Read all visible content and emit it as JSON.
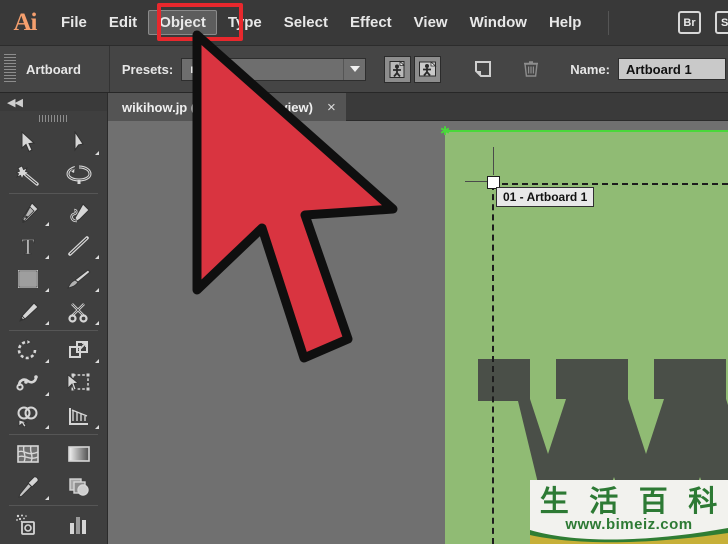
{
  "app": {
    "name": "Adobe Illustrator",
    "logo_text": "Ai"
  },
  "menubar": {
    "items": [
      {
        "label": "File",
        "active": false
      },
      {
        "label": "Edit",
        "active": false
      },
      {
        "label": "Object",
        "active": true
      },
      {
        "label": "Type",
        "active": false
      },
      {
        "label": "Select",
        "active": false
      },
      {
        "label": "Effect",
        "active": false
      },
      {
        "label": "View",
        "active": false
      },
      {
        "label": "Window",
        "active": false
      },
      {
        "label": "Help",
        "active": false
      }
    ],
    "right_buttons": [
      {
        "label": "Br",
        "name": "bridge-button"
      },
      {
        "label": "St",
        "name": "stock-button"
      }
    ],
    "highlight_color": "#e8282d",
    "highlighted_item": "Object"
  },
  "optionsbar": {
    "panel_label": "Artboard",
    "presets_label": "Presets:",
    "presets_value": "m",
    "name_label": "Name:",
    "name_value": "Artboard 1",
    "buttons": [
      {
        "name": "portrait-artboard-button",
        "state": "on"
      },
      {
        "name": "landscape-artboard-button",
        "state": "on"
      },
      {
        "name": "new-artboard-button",
        "state": "off"
      },
      {
        "name": "delete-artboard-button",
        "state": "disabled"
      }
    ]
  },
  "document": {
    "tab_label": "wikihow.jp           (RGB/GPU Preview)",
    "close_label": "×"
  },
  "tools": [
    {
      "name": "selection-tool",
      "icon": "selection-arrow-icon",
      "has_flyout": false
    },
    {
      "name": "direct-selection-tool",
      "icon": "direct-selection-arrow-icon",
      "has_flyout": true
    },
    {
      "name": "magic-wand-tool",
      "icon": "magic-wand-icon",
      "has_flyout": false
    },
    {
      "name": "lasso-tool",
      "icon": "lasso-icon",
      "has_flyout": false
    },
    {
      "name": "pen-tool",
      "icon": "pen-nib-icon",
      "has_flyout": true
    },
    {
      "name": "curvature-tool",
      "icon": "curvature-pen-icon",
      "has_flyout": false
    },
    {
      "name": "type-tool",
      "icon": "type-t-icon",
      "has_flyout": true
    },
    {
      "name": "line-segment-tool",
      "icon": "line-segment-icon",
      "has_flyout": true
    },
    {
      "name": "rectangle-tool",
      "icon": "rectangle-icon",
      "has_flyout": true
    },
    {
      "name": "paintbrush-tool",
      "icon": "paintbrush-icon",
      "has_flyout": true
    },
    {
      "name": "pencil-tool",
      "icon": "pencil-icon",
      "has_flyout": true
    },
    {
      "name": "scissors-tool",
      "icon": "scissors-icon",
      "has_flyout": true
    },
    {
      "name": "rotate-tool",
      "icon": "rotate-icon",
      "has_flyout": true
    },
    {
      "name": "scale-tool",
      "icon": "scale-icon",
      "has_flyout": true
    },
    {
      "name": "width-tool",
      "icon": "width-warp-icon",
      "has_flyout": true
    },
    {
      "name": "free-transform-tool",
      "icon": "free-transform-icon",
      "has_flyout": false
    },
    {
      "name": "shape-builder-tool",
      "icon": "shape-builder-icon",
      "has_flyout": true
    },
    {
      "name": "perspective-grid-tool",
      "icon": "perspective-grid-icon",
      "has_flyout": true
    },
    {
      "name": "mesh-tool",
      "icon": "mesh-icon",
      "has_flyout": false
    },
    {
      "name": "gradient-tool",
      "icon": "gradient-icon",
      "has_flyout": false
    },
    {
      "name": "eyedropper-tool",
      "icon": "eyedropper-icon",
      "has_flyout": true
    },
    {
      "name": "blend-tool",
      "icon": "blend-icon",
      "has_flyout": false
    },
    {
      "name": "symbol-sprayer-tool",
      "icon": "symbol-sprayer-icon",
      "has_flyout": false
    },
    {
      "name": "column-graph-tool",
      "icon": "bar-graph-icon",
      "has_flyout": false
    }
  ],
  "canvas": {
    "artboard_tag": "01 - Artboard 1",
    "artboard_color": "#90bb74",
    "background_color": "#707070",
    "guide_color": "#49d83a",
    "logo_letter": "W",
    "logo_color": "#4a4f48"
  },
  "watermark": {
    "cjk_chars": [
      "生",
      "活",
      "百",
      "科"
    ],
    "url": "www.bimeiz.com",
    "text_color": "#2d7a34"
  },
  "cursor": {
    "name": "mouse-pointer",
    "fill": "#d93440",
    "stroke": "#0f0f0f"
  }
}
